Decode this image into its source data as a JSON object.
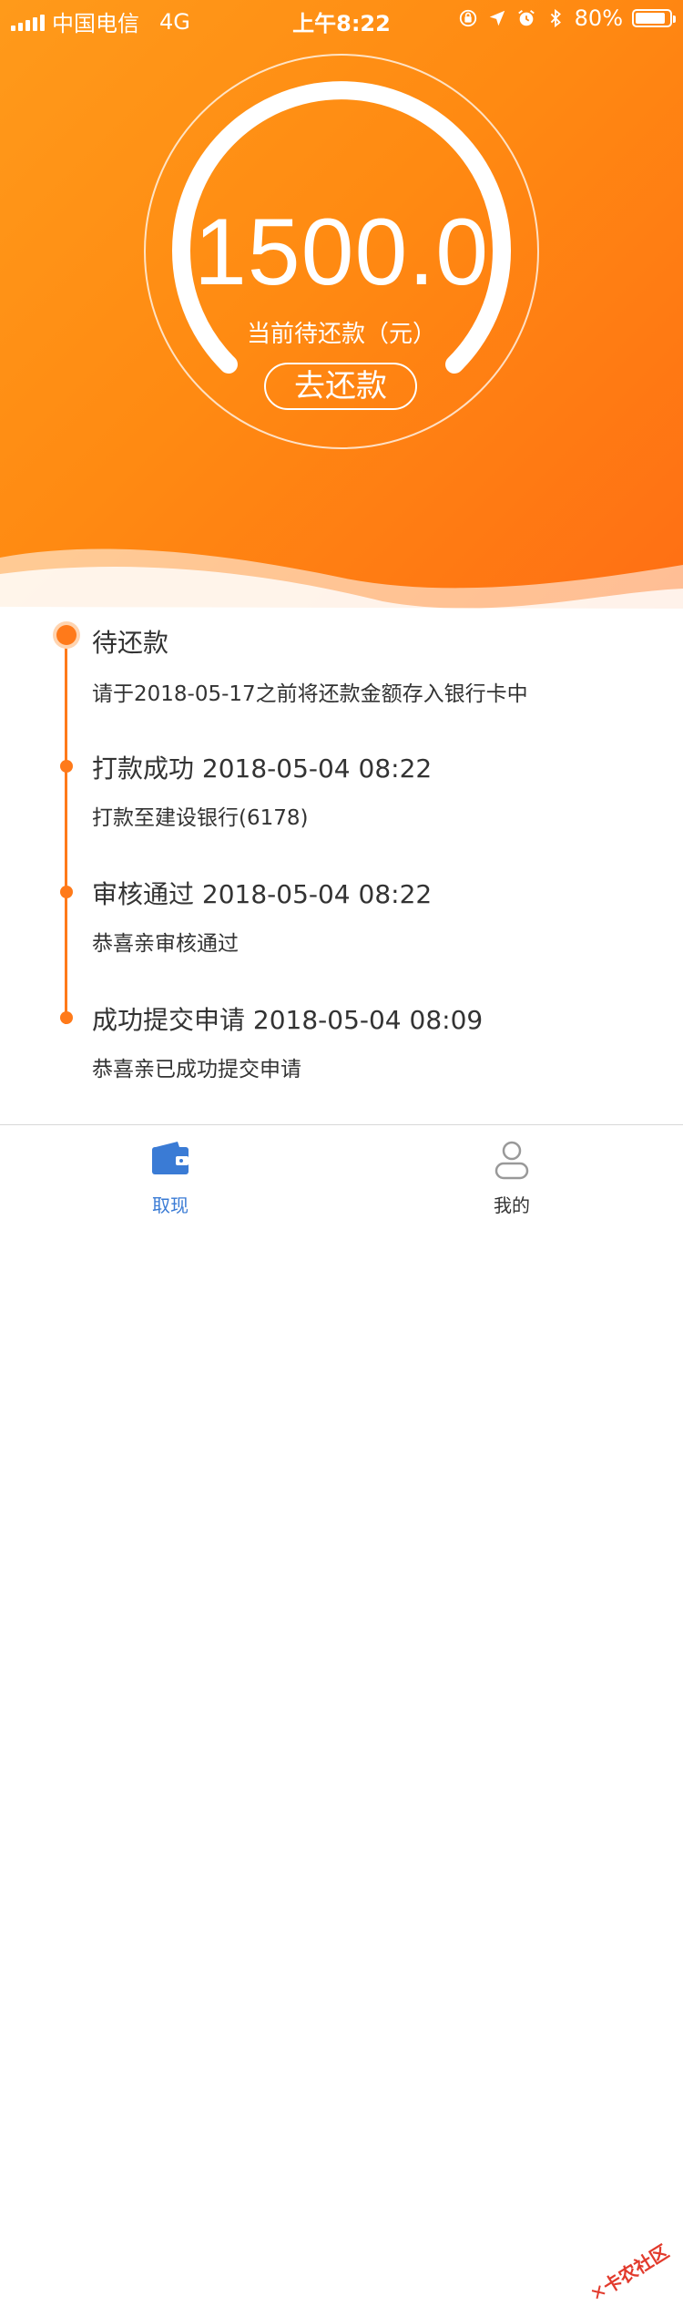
{
  "status_bar": {
    "carrier": "中国电信",
    "network": "4G",
    "time": "上午8:22",
    "battery_percent": "80%"
  },
  "hero": {
    "amount": "1500.0",
    "amount_label": "当前待还款（元）",
    "repay_button": "去还款"
  },
  "timeline": [
    {
      "title": "待还款",
      "desc": "请于2018-05-17之前将还款金额存入银行卡中"
    },
    {
      "title": "打款成功 2018-05-04 08:22",
      "desc": "打款至建设银行(6178)"
    },
    {
      "title": "审核通过 2018-05-04 08:22",
      "desc": "恭喜亲审核通过"
    },
    {
      "title": "成功提交申请 2018-05-04 08:09",
      "desc": "恭喜亲已成功提交申请"
    }
  ],
  "tabbar": {
    "tabs": [
      {
        "label": "取现",
        "icon": "wallet-icon",
        "active": true
      },
      {
        "label": "我的",
        "icon": "user-icon",
        "active": false
      }
    ],
    "active_color": "#3a7bd5",
    "inactive_color": "#999999"
  },
  "watermark": "卡农社区",
  "colors": {
    "accent": "#ff7a1a",
    "hero_start": "#ff9a1a",
    "hero_end": "#ff6e14"
  }
}
